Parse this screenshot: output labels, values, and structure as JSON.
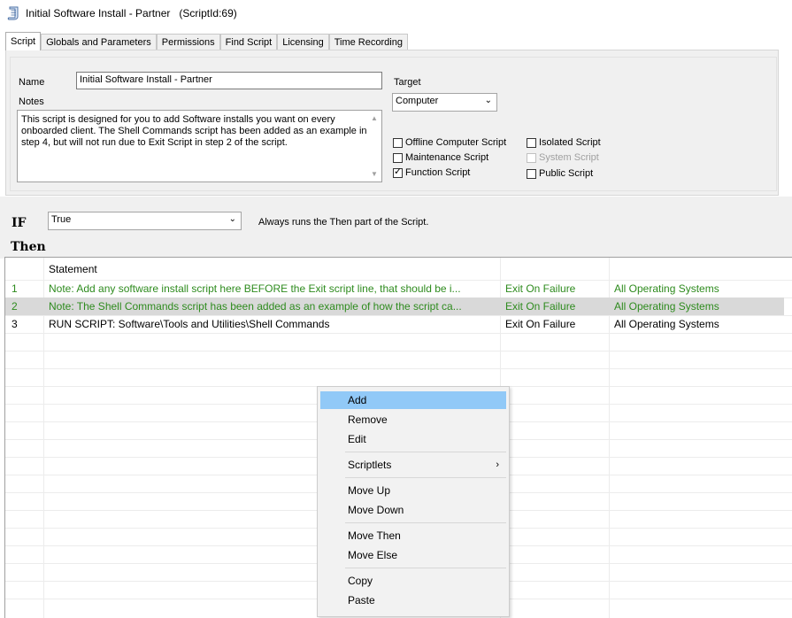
{
  "window": {
    "title": "Initial Software Install - Partner",
    "script_id": "(ScriptId:69)"
  },
  "tabs": [
    {
      "label": "Script",
      "active": true
    },
    {
      "label": "Globals and Parameters"
    },
    {
      "label": "Permissions"
    },
    {
      "label": "Find Script"
    },
    {
      "label": "Licensing"
    },
    {
      "label": "Time Recording"
    }
  ],
  "form": {
    "name_label": "Name",
    "name_value": "Initial Software Install - Partner",
    "notes_label": "Notes",
    "notes_value": "This script is designed for you to add Software installs you want on every onboarded client.  The Shell Commands script has been added as an example in step 4, but will not run due to Exit Script in step 2 of the script.",
    "target_label": "Target",
    "target_value": "Computer",
    "checkboxes": {
      "offline": {
        "label": "Offline Computer Script",
        "checked": false
      },
      "maintenance": {
        "label": "Maintenance Script",
        "checked": false
      },
      "function": {
        "label": "Function Script",
        "checked": true
      },
      "isolated": {
        "label": "Isolated Script",
        "checked": false
      },
      "system": {
        "label": "System Script",
        "checked": false,
        "disabled": true
      },
      "public": {
        "label": "Public Script",
        "checked": false
      }
    }
  },
  "if_section": {
    "if_label": "IF",
    "condition": "True",
    "description": "Always runs the Then part of the Script.",
    "then_label": "Then"
  },
  "grid": {
    "header": "Statement",
    "rows": [
      {
        "num": "1",
        "statement": "Note: Add any software install script here BEFORE the Exit script line, that should be i...",
        "on_failure": "Exit On Failure",
        "os": "All Operating Systems",
        "color": "#2e8b1e"
      },
      {
        "num": "2",
        "statement": "Note: The Shell Commands script has been added as an example of how the script ca...",
        "on_failure": "Exit On Failure",
        "os": "All Operating Systems",
        "color": "#2e8b1e",
        "selected": true
      },
      {
        "num": "3",
        "statement": "RUN SCRIPT:  Software\\Tools and Utilities\\Shell Commands",
        "on_failure": "Exit On Failure",
        "os": "All Operating Systems",
        "color": "#000000"
      }
    ]
  },
  "context_menu": {
    "items": {
      "add": "Add",
      "remove": "Remove",
      "edit": "Edit",
      "scriptlets": "Scriptlets",
      "move_up": "Move Up",
      "move_down": "Move Down",
      "move_then": "Move Then",
      "move_else": "Move Else",
      "copy": "Copy",
      "paste": "Paste"
    },
    "highlighted": "Add",
    "highlight_color": "#91c9f7"
  },
  "colors": {
    "note_green": "#2e8b1e",
    "selection_gray": "#d9d9d9",
    "panel_bg": "#f0f0f0"
  }
}
